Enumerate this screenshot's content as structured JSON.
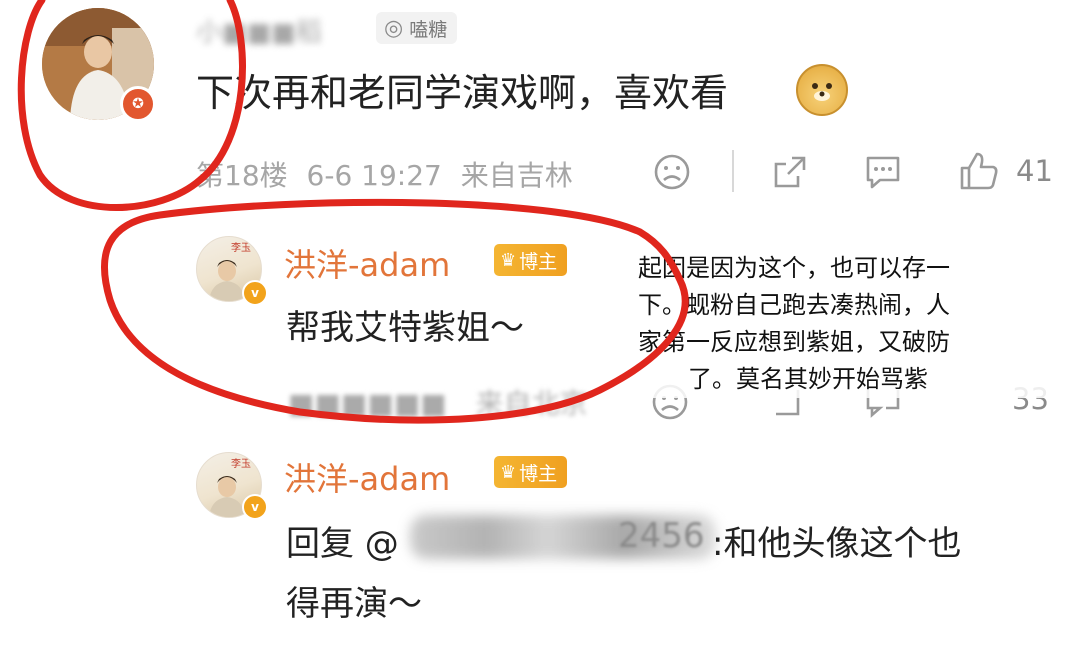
{
  "main_comment": {
    "username": "小■■■稻",
    "tag": "嗑糖",
    "text": "下次再和老同学演戏啊，喜欢看",
    "floor": "第18楼",
    "time": "6-6 19:27",
    "location": "来自吉林",
    "like_count": "41"
  },
  "reply1": {
    "username": "洪洋-adam",
    "badge": "博主",
    "text": "帮我艾特紫姐～",
    "location": "来自北京",
    "like_count": "33"
  },
  "reply2": {
    "username": "洪洋-adam",
    "badge": "博主",
    "text_prefix": "回复 @",
    "mention_tail": "2456",
    "text_line1_suffix": ":和他头像这个也",
    "text_line2": "得再演～"
  },
  "annotation": {
    "line1": "起因是因为这个，也可以存一",
    "line2": "下。蚬粉自己跑去凑热闹，人",
    "line3": "家第一反应想到紫姐，又破防",
    "line4": "了。莫名其妙开始骂紫"
  },
  "avatar_text": "李玉",
  "colors": {
    "annotation_red": "#e0261d",
    "username_orange": "#e2753a",
    "meta_gray": "#a6a6a6"
  },
  "icons": [
    "sad-face-icon",
    "share-icon",
    "comment-icon",
    "thumbs-up-icon"
  ]
}
